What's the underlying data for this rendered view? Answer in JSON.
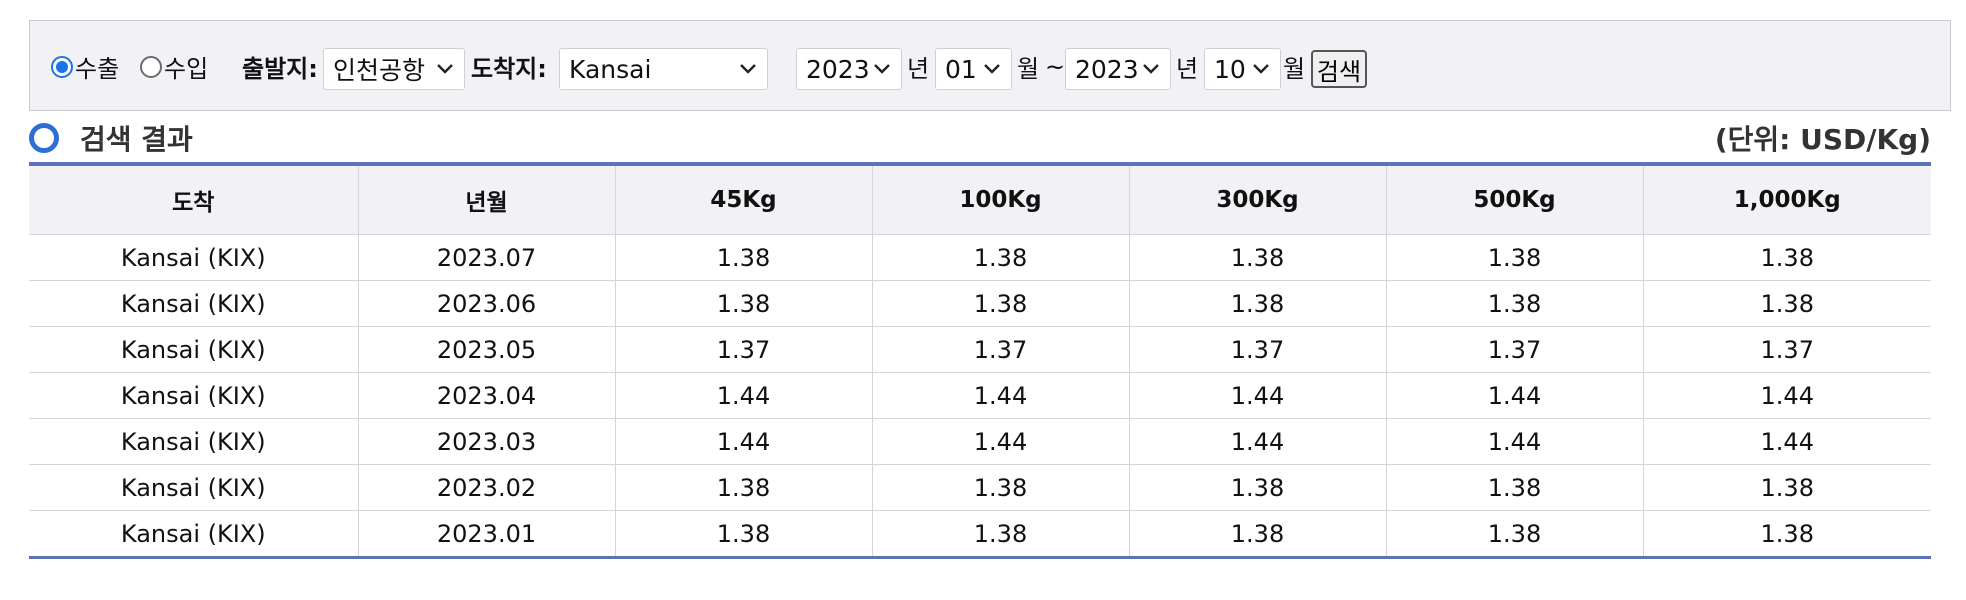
{
  "filter": {
    "direction_options": [
      {
        "label": "수출",
        "checked": true
      },
      {
        "label": "수입",
        "checked": false
      }
    ],
    "origin_label": "출발지:",
    "origin_value": "인천공항",
    "dest_label": "도착지:",
    "dest_value": "Kansai",
    "from_year": "2023",
    "from_year_suffix": "년",
    "from_month": "01",
    "from_month_suffix": "월",
    "range_separator": "~",
    "to_year": "2023",
    "to_year_suffix": "년",
    "to_month": "10",
    "to_month_suffix": "월",
    "search_label": "검색"
  },
  "results": {
    "title": "검색 결과",
    "unit": "(단위: USD/Kg)",
    "headers": [
      "도착",
      "년월",
      "45Kg",
      "100Kg",
      "300Kg",
      "500Kg",
      "1,000Kg"
    ],
    "rows": [
      [
        "Kansai (KIX)",
        "2023.07",
        "1.38",
        "1.38",
        "1.38",
        "1.38",
        "1.38"
      ],
      [
        "Kansai (KIX)",
        "2023.06",
        "1.38",
        "1.38",
        "1.38",
        "1.38",
        "1.38"
      ],
      [
        "Kansai (KIX)",
        "2023.05",
        "1.37",
        "1.37",
        "1.37",
        "1.37",
        "1.37"
      ],
      [
        "Kansai (KIX)",
        "2023.04",
        "1.44",
        "1.44",
        "1.44",
        "1.44",
        "1.44"
      ],
      [
        "Kansai (KIX)",
        "2023.03",
        "1.44",
        "1.44",
        "1.44",
        "1.44",
        "1.44"
      ],
      [
        "Kansai (KIX)",
        "2023.02",
        "1.38",
        "1.38",
        "1.38",
        "1.38",
        "1.38"
      ],
      [
        "Kansai (KIX)",
        "2023.01",
        "1.38",
        "1.38",
        "1.38",
        "1.38",
        "1.38"
      ]
    ]
  },
  "colors": {
    "accent": "#2e6fd6",
    "table_rule": "#5b74b8",
    "filter_bg": "#f2f2f6",
    "header_bg": "#f2f2f6"
  },
  "icons": {
    "results_marker": "circle-icon",
    "dropdown": "chevron-down-icon"
  }
}
